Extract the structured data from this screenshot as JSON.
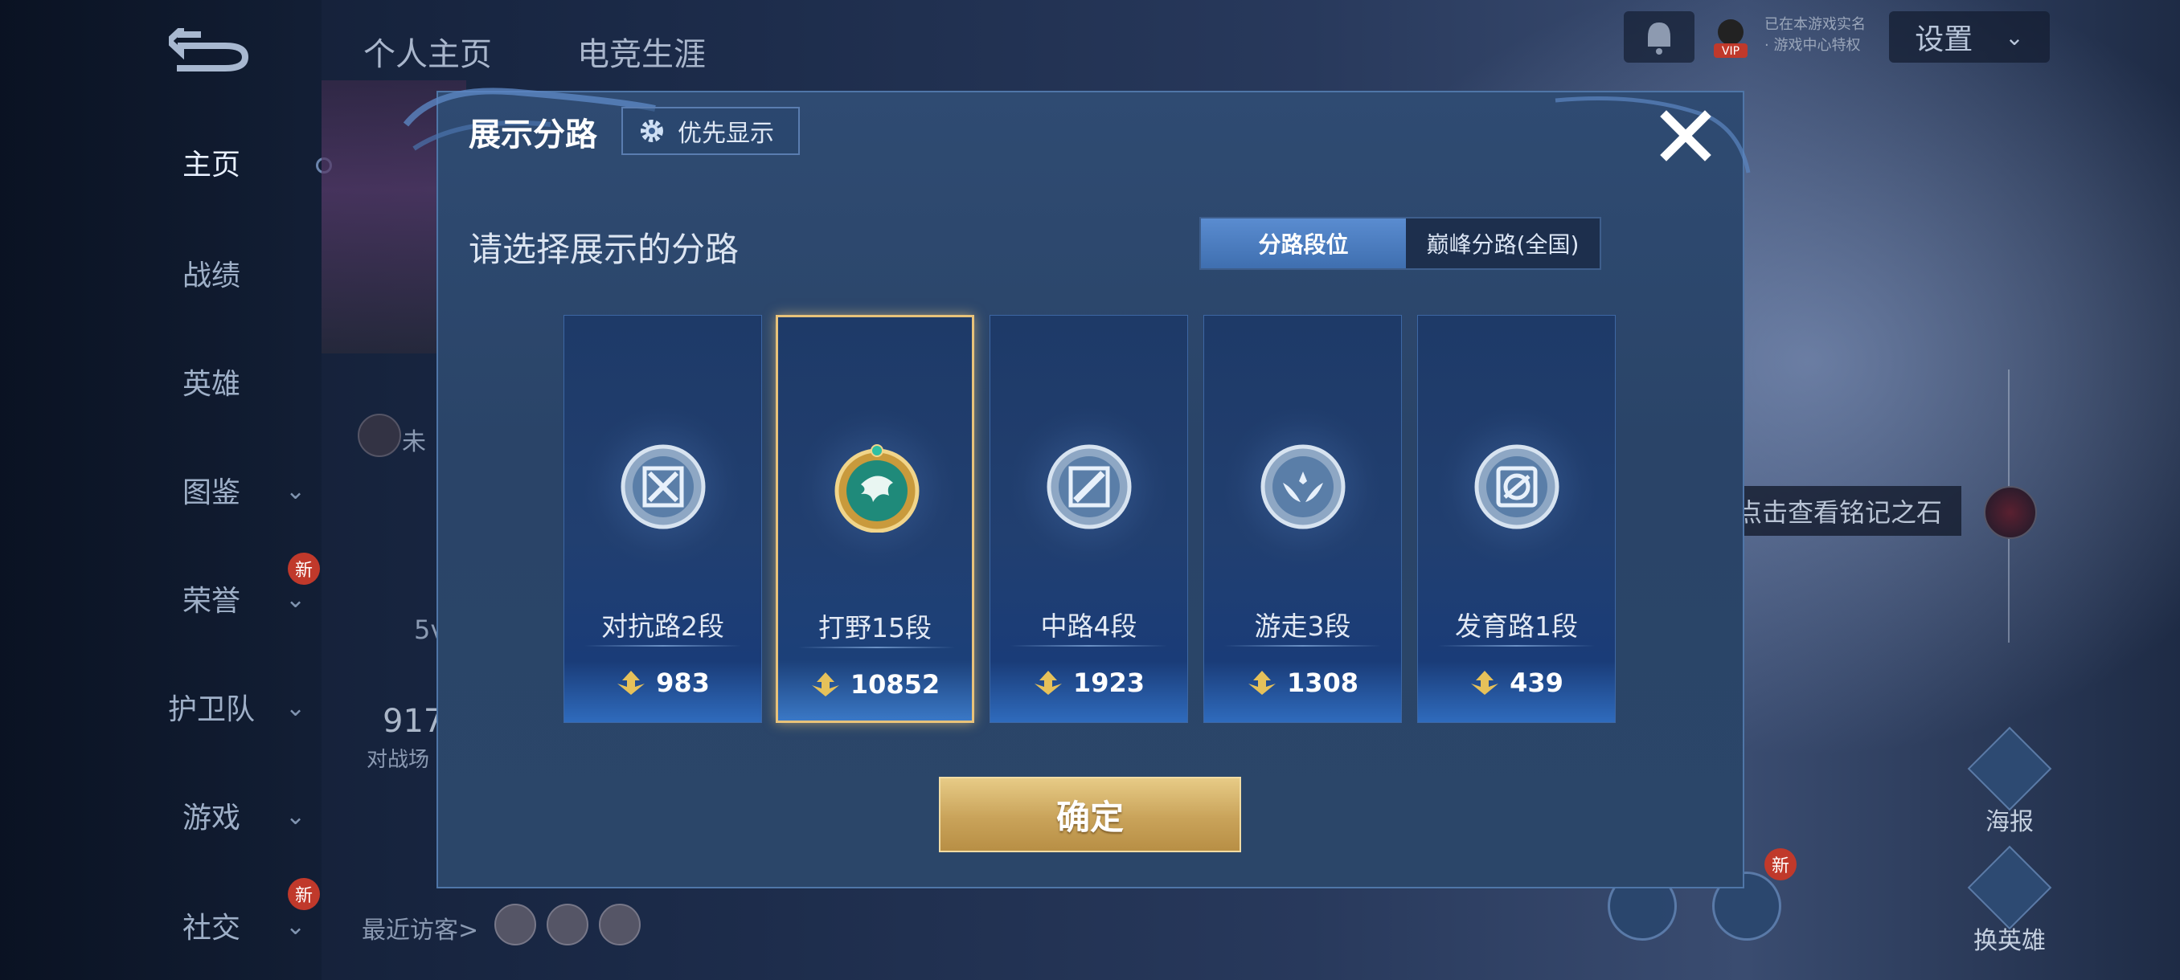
{
  "background": {
    "top_tabs": [
      "个人主页",
      "电竞生涯"
    ],
    "settings_label": "设置",
    "vip_text": [
      "已在本游戏实名",
      "· 游戏中心特权"
    ],
    "vip_badge": "VIP",
    "nav": [
      {
        "label": "主页",
        "active": true,
        "chevron": false
      },
      {
        "label": "战绩",
        "active": false,
        "chevron": false
      },
      {
        "label": "英雄",
        "active": false,
        "chevron": false
      },
      {
        "label": "图鉴",
        "active": false,
        "chevron": true
      },
      {
        "label": "荣誉",
        "active": false,
        "chevron": true,
        "badge": "新"
      },
      {
        "label": "护卫队",
        "active": false,
        "chevron": true
      },
      {
        "label": "游戏",
        "active": false,
        "chevron": true
      },
      {
        "label": "社交",
        "active": false,
        "chevron": true,
        "badge": "新"
      }
    ],
    "recent_visitors_label": "最近访客>",
    "stat_value": "917",
    "stat_label": "对战场",
    "mode_text": "5v",
    "mute_text": "未",
    "inscription_hint": "点击查看铭记之石",
    "side_buttons": [
      {
        "label": "海报"
      },
      {
        "label": "换英雄"
      }
    ],
    "new_badge": "新"
  },
  "modal": {
    "title": "展示分路",
    "priority_label": "优先显示",
    "subtitle": "请选择展示的分路",
    "tabs": [
      {
        "label": "分路段位",
        "active": true
      },
      {
        "label": "巅峰分路(全国)",
        "active": false
      }
    ],
    "cards": [
      {
        "role": "对抗路2段",
        "score": "983",
        "icon": "clash-lane-icon",
        "selected": false
      },
      {
        "role": "打野15段",
        "score": "10852",
        "icon": "jungle-dragon-icon",
        "selected": true
      },
      {
        "role": "中路4段",
        "score": "1923",
        "icon": "mid-lane-icon",
        "selected": false
      },
      {
        "role": "游走3段",
        "score": "1308",
        "icon": "roam-wings-icon",
        "selected": false
      },
      {
        "role": "发育路1段",
        "score": "439",
        "icon": "farm-lane-icon",
        "selected": false
      }
    ],
    "confirm_label": "确定"
  },
  "colors": {
    "accent_gold": "#e8c27a",
    "modal_bg": "#2b4669",
    "tab_active": "#4a7ec2",
    "confirm_gold": "#c9a35a"
  }
}
